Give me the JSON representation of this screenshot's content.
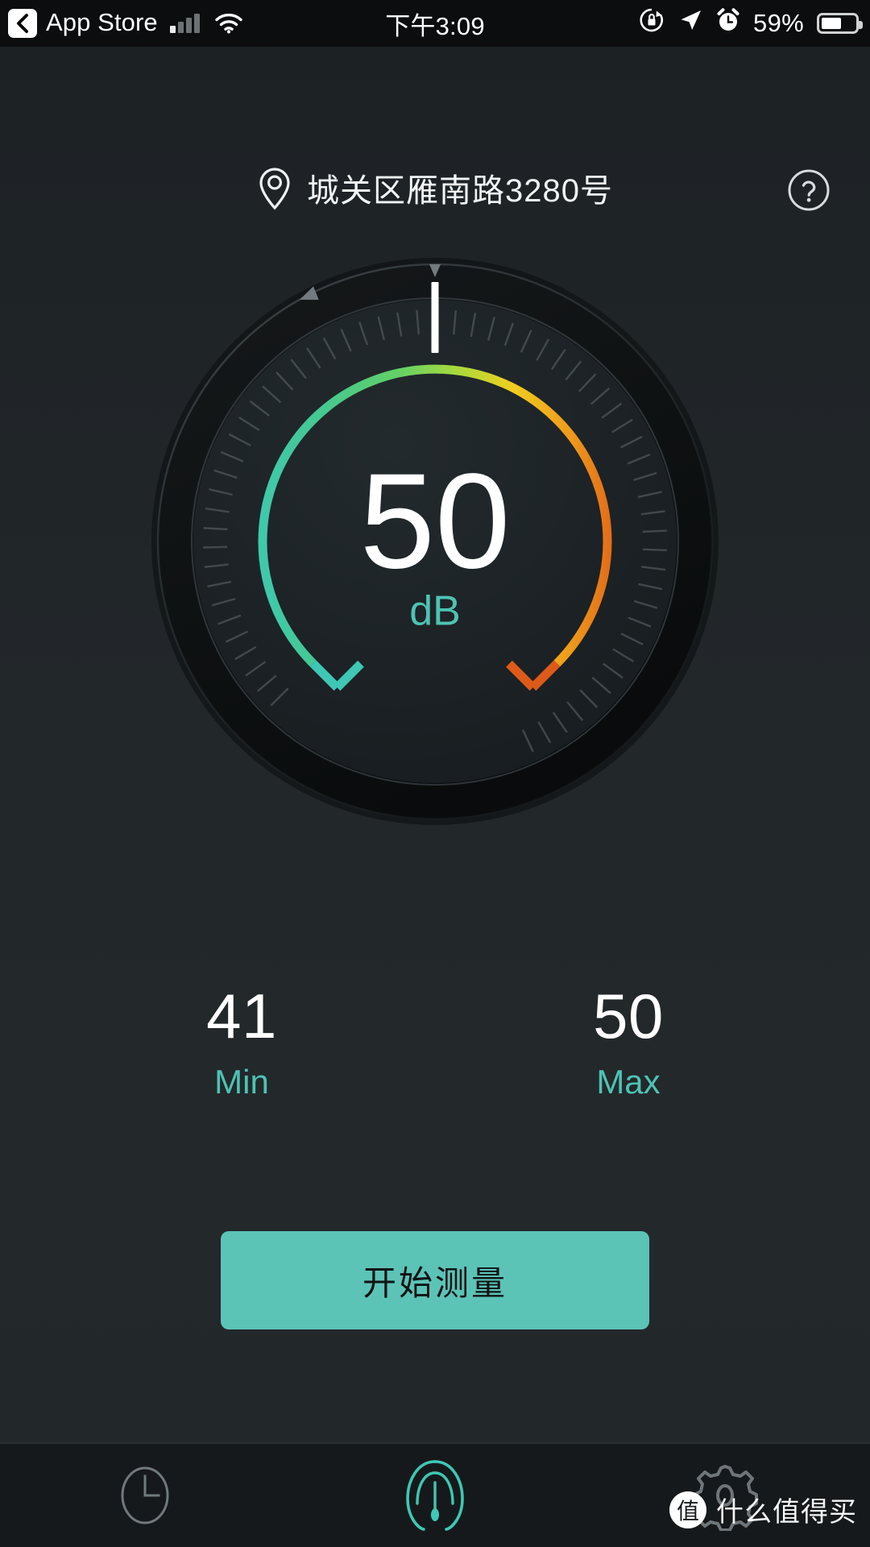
{
  "status_bar": {
    "back_label": "App Store",
    "back_icon": "chevron-left-icon",
    "signal_icon": "cellular-signal-icon",
    "signal_bars_active": 1,
    "wifi_icon": "wifi-icon",
    "time": "下午3:09",
    "rotation_lock_icon": "rotation-lock-icon",
    "location_icon": "location-arrow-icon",
    "alarm_icon": "alarm-clock-icon",
    "battery_percent": "59%",
    "battery_level": 59,
    "battery_icon": "battery-icon"
  },
  "header": {
    "location_icon": "map-pin-icon",
    "location_text": "城关区雁南路3280号",
    "help_icon": "question-mark-circle-icon"
  },
  "gauge": {
    "value": "50",
    "unit": "dB",
    "unit_color": "#4ec3b4",
    "value_color": "#ffffff",
    "arc_start_color": "#3ec7b4",
    "arc_mid_color": "#f2d01e",
    "arc_end_color": "#e3651b",
    "needle_color": "#ffffff",
    "tick_color": "#5a6166",
    "marker_icon": "triangle-marker-icon"
  },
  "stats": [
    {
      "value": "41",
      "label": "Min"
    },
    {
      "value": "50",
      "label": "Max"
    }
  ],
  "action": {
    "label": "开始测量",
    "bg_color": "#5cc3b7",
    "text_color": "#101314"
  },
  "tabs": [
    {
      "name": "history",
      "icon": "clock-icon",
      "active": false
    },
    {
      "name": "meter",
      "icon": "gauge-icon",
      "active": true
    },
    {
      "name": "settings",
      "icon": "gear-icon",
      "active": false
    }
  ],
  "watermark": {
    "badge": "值",
    "text": "什么值得买"
  },
  "chart_data": {
    "type": "gauge",
    "title": "Sound Level Meter",
    "value": 50,
    "unit": "dB",
    "range": [
      30,
      130
    ],
    "arc_sweep_degrees": 270,
    "arc_start_angle_deg": 135,
    "gradient_stops": [
      {
        "offset": 0.0,
        "color": "#3ec7b4"
      },
      {
        "offset": 0.35,
        "color": "#5fcf6d"
      },
      {
        "offset": 0.55,
        "color": "#b9dc34"
      },
      {
        "offset": 0.72,
        "color": "#f2d01e"
      },
      {
        "offset": 1.0,
        "color": "#e3651b"
      }
    ],
    "needle_value": 50,
    "markers": [
      {
        "label": "current",
        "angle_deg": 270
      },
      {
        "label": "reference",
        "angle_deg": 247
      }
    ],
    "stats": {
      "min": 41,
      "max": 50
    },
    "ticks": {
      "count": 60,
      "color": "#5a6166"
    }
  }
}
